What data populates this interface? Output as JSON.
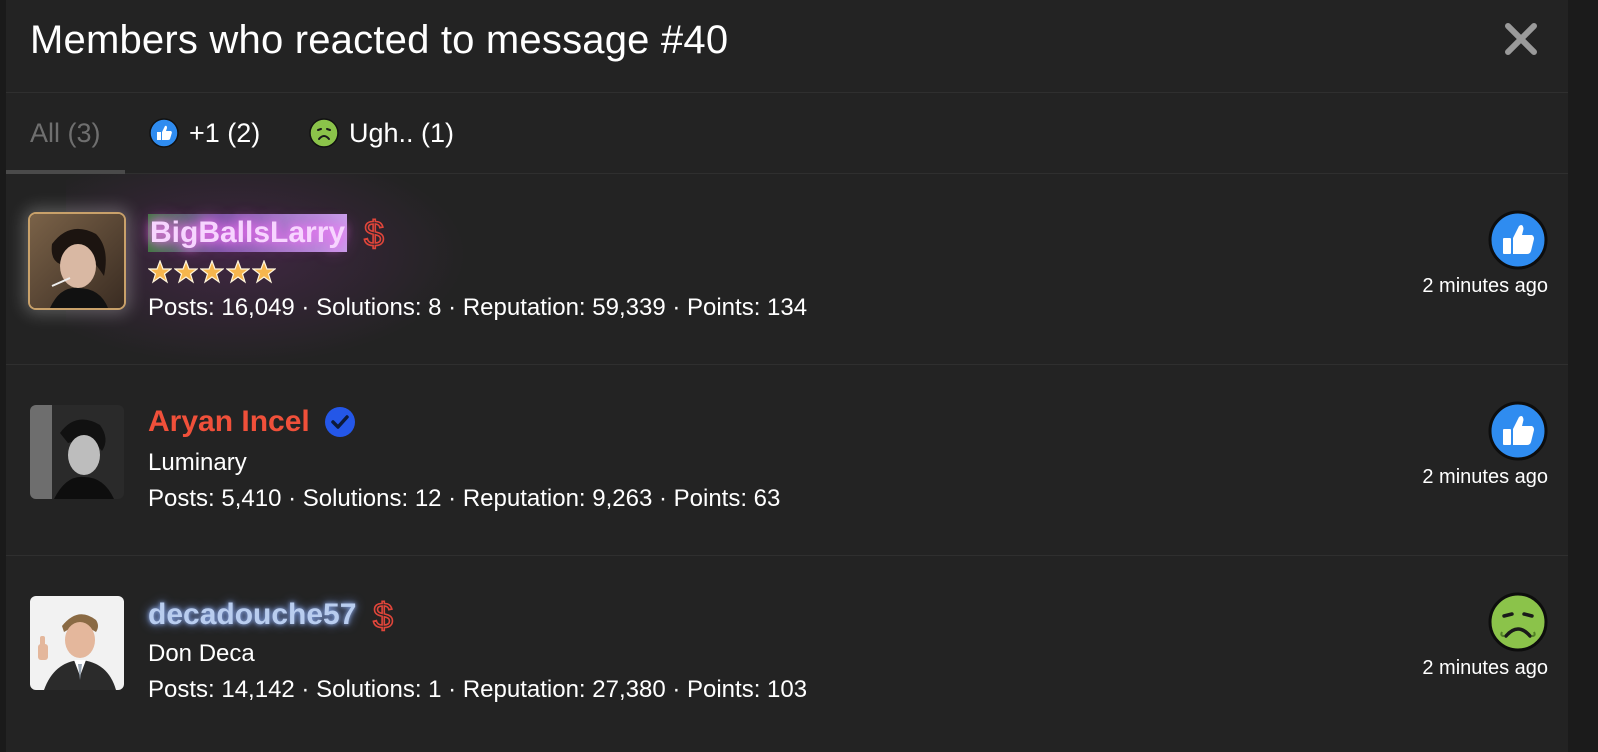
{
  "modal": {
    "title": "Members who reacted to message #40"
  },
  "tabs": [
    {
      "label": "All (3)",
      "active": true
    },
    {
      "label": "+1 (2)",
      "icon": "thumbs-up-icon"
    },
    {
      "label": "Ugh.. (1)",
      "icon": "sick-face-icon"
    }
  ],
  "members": [
    {
      "username": "BigBallsLarry",
      "title_display": "stars",
      "stars": 5,
      "badge": "dollar-icon",
      "stats": "Posts: 16,049 · Solutions: 8 · Reputation: 59,339 · Points: 134",
      "reaction": "thumbs-up-icon",
      "time": "2 minutes ago"
    },
    {
      "username": "Aryan Incel",
      "title": "Luminary",
      "badge": "verified-check-icon",
      "stats": "Posts: 5,410 · Solutions: 12 · Reputation: 9,263 · Points: 63",
      "reaction": "thumbs-up-icon",
      "time": "2 minutes ago"
    },
    {
      "username": "decadouche57",
      "title": "Don Deca",
      "badge": "dollar-icon",
      "stats": "Posts: 14,142 · Solutions: 1 · Reputation: 27,380 · Points: 103",
      "reaction": "sick-face-icon",
      "time": "2 minutes ago"
    }
  ],
  "colors": {
    "background": "#232323",
    "thumbs_blue": "#2f8cf0",
    "sick_green": "#8bc34a",
    "verified_blue": "#2457e8",
    "username_red": "#f0503a"
  }
}
